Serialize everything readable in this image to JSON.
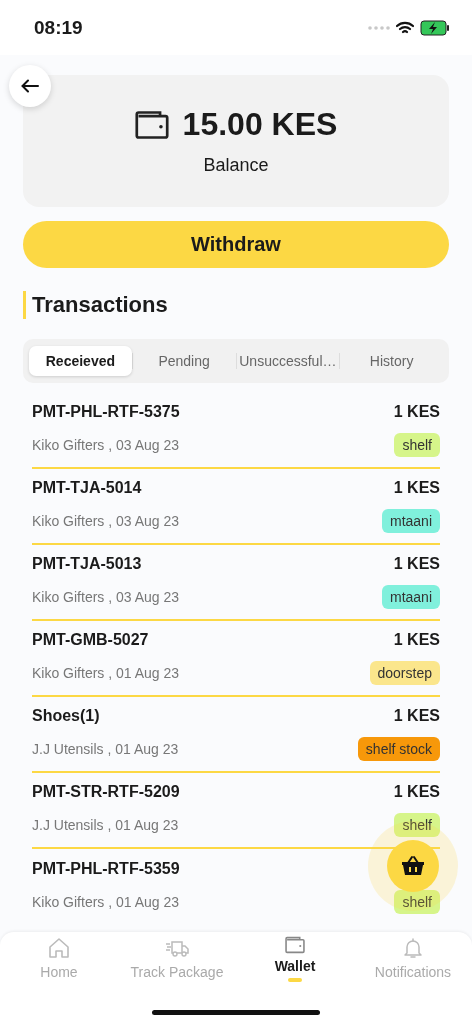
{
  "status_bar": {
    "time": "08:19"
  },
  "balance": {
    "amount": "15.00 KES",
    "label": "Balance"
  },
  "withdraw_button": "Withdraw",
  "section_title": "Transactions",
  "tabs": [
    {
      "label": "Receieved",
      "selected": true
    },
    {
      "label": "Pending",
      "selected": false
    },
    {
      "label": "Unsuccessful…",
      "selected": false
    },
    {
      "label": "History",
      "selected": false
    }
  ],
  "transactions": [
    {
      "reference": "PMT-PHL-RTF-5375",
      "amount": "1 KES",
      "detail": "Kiko Gifters , 03 Aug 23",
      "tag": "shelf",
      "color": "#d6f58a"
    },
    {
      "reference": "PMT-TJA-5014",
      "amount": "1 KES",
      "detail": "Kiko Gifters , 03 Aug 23",
      "tag": "mtaani",
      "color": "#80f0dc"
    },
    {
      "reference": "PMT-TJA-5013",
      "amount": "1 KES",
      "detail": "Kiko Gifters , 03 Aug 23",
      "tag": "mtaani",
      "color": "#80f0dc"
    },
    {
      "reference": "PMT-GMB-5027",
      "amount": "1 KES",
      "detail": "Kiko Gifters , 01 Aug 23",
      "tag": "doorstep",
      "color": "#fbe68c"
    },
    {
      "reference": "Shoes(1)",
      "amount": "1 KES",
      "detail": "J.J Utensils , 01 Aug 23",
      "tag": "shelf stock",
      "color": "#f7980a"
    },
    {
      "reference": "PMT-STR-RTF-5209",
      "amount": "1 KES",
      "detail": "J.J Utensils , 01 Aug 23",
      "tag": "shelf",
      "color": "#d6f58a"
    },
    {
      "reference": "PMT-PHL-RTF-5359",
      "detail": "Kiko Gifters , 01 Aug 23",
      "tag": "shelf",
      "color": "#d6f58a"
    }
  ],
  "bottom_nav": [
    {
      "label": "Home",
      "selected": false
    },
    {
      "label": "Track Package",
      "selected": false
    },
    {
      "label": "Wallet",
      "selected": true
    },
    {
      "label": "Notifications",
      "selected": false
    }
  ]
}
